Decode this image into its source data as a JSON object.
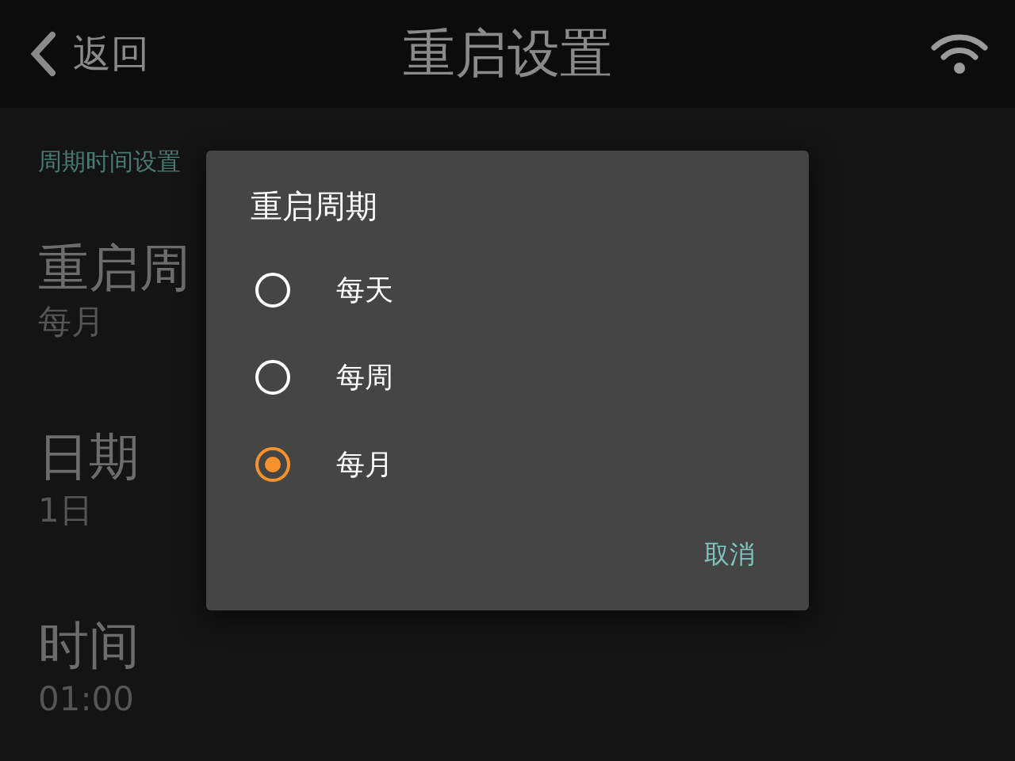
{
  "header": {
    "back_label": "返回",
    "title": "重启设置"
  },
  "section_label": "周期时间设置",
  "settings": [
    {
      "name": "重启周",
      "value": "每月"
    },
    {
      "name": "日期",
      "value": "1日"
    },
    {
      "name": "时间",
      "value": "01:00"
    }
  ],
  "dialog": {
    "title": "重启周期",
    "options": [
      {
        "label": "每天",
        "selected": false
      },
      {
        "label": "每周",
        "selected": false
      },
      {
        "label": "每月",
        "selected": true
      }
    ],
    "cancel": "取消"
  }
}
